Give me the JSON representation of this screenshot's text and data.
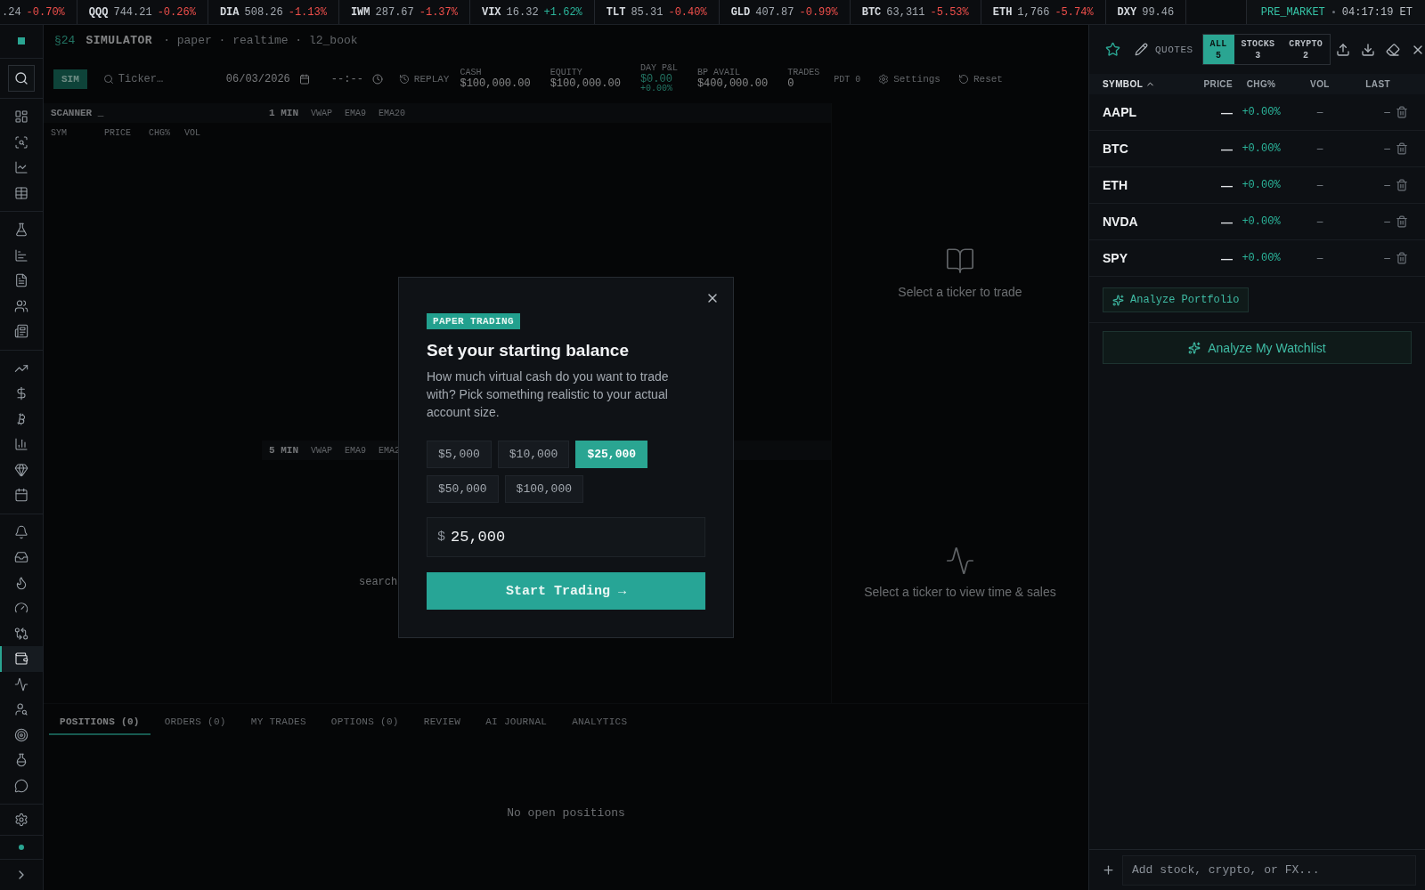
{
  "ticker": {
    "items": [
      {
        "price": ".24",
        "change": "-0.70%",
        "color": "#ef4f4b"
      },
      {
        "symbol": "QQQ",
        "price": "744.21",
        "change": "-0.26%",
        "color": "#ef4f4b"
      },
      {
        "symbol": "DIA",
        "price": "508.26",
        "change": "-1.13%",
        "color": "#ef4f4b"
      },
      {
        "symbol": "IWM",
        "price": "287.67",
        "change": "-1.37%",
        "color": "#ef4f4b"
      },
      {
        "symbol": "VIX",
        "price": "16.32",
        "change": "+1.62%",
        "color": "#2bb59b"
      },
      {
        "symbol": "TLT",
        "price": "85.31",
        "change": "-0.40%",
        "color": "#ef4f4b"
      },
      {
        "symbol": "GLD",
        "price": "407.87",
        "change": "-0.99%",
        "color": "#ef4f4b"
      },
      {
        "symbol": "BTC",
        "price": "63,311",
        "change": "-5.53%",
        "color": "#ef4f4b"
      },
      {
        "symbol": "ETH",
        "price": "1,766",
        "change": "-5.74%",
        "color": "#ef4f4b"
      },
      {
        "symbol": "DXY",
        "price": "99.46"
      }
    ],
    "session": "PRE_MARKET",
    "time": "04:17:19 ET"
  },
  "sidebar": {
    "groups": [
      {
        "items": [
          {
            "selected": false
          },
          {
            "selected": false
          },
          {
            "selected": false
          },
          {
            "selected": false
          }
        ]
      },
      {
        "items": [
          {
            "selected": false
          },
          {
            "selected": false
          },
          {
            "selected": false
          },
          {
            "selected": false
          },
          {
            "selected": false
          }
        ]
      },
      {
        "items": [
          {
            "selected": false
          },
          {
            "selected": false
          },
          {
            "selected": false
          },
          {
            "selected": false
          },
          {
            "selected": false
          },
          {
            "selected": false
          }
        ]
      },
      {
        "items": [
          {
            "selected": false
          },
          {
            "selected": false
          },
          {
            "selected": false
          },
          {
            "selected": false
          },
          {
            "selected": false
          },
          {
            "selected": true
          },
          {
            "selected": false
          },
          {
            "selected": false
          },
          {
            "selected": false
          },
          {
            "selected": false
          },
          {
            "selected": false
          }
        ]
      }
    ]
  },
  "main": {
    "header": {
      "code": "§24",
      "title": "SIMULATOR",
      "meta": "· paper · realtime · l2_book"
    },
    "toolbar": {
      "mode": "SIM",
      "ticker_placeholder": "Ticker…",
      "date": "06/03/2026",
      "time": "--:--",
      "replay": "REPLAY",
      "stats": [
        {
          "label": "CASH",
          "value": "$100,000.00"
        },
        {
          "label": "EQUITY",
          "value": "$100,000.00"
        },
        {
          "label": "DAY P&L",
          "value": "$0.00",
          "sub": "+0.00%",
          "kind": "pnl"
        },
        {
          "label": "BP AVAIL",
          "value": "$400,000.00"
        },
        {
          "label": "TRADES",
          "value": "0"
        }
      ],
      "pdt": "PDT 0",
      "settings": "Settings",
      "reset": "Reset"
    },
    "scanner": {
      "title": "SCANNER _",
      "columns": [
        "SYM",
        "PRICE",
        "CHG%",
        "VOL"
      ]
    },
    "charts": [
      {
        "timeframe": "1 MIN",
        "indicators": [
          "VWAP",
          "EMA9",
          "EMA20"
        ]
      },
      {
        "timeframe": "5 MIN",
        "indicators": [
          "VWAP",
          "EMA9",
          "EMA2"
        ],
        "hint": "search"
      }
    ],
    "side_panels": [
      {
        "message": "Select a ticker to trade"
      },
      {
        "message": "Select a ticker to view time & sales"
      }
    ],
    "bottom_tabs": [
      {
        "label": "POSITIONS (0)",
        "selected": true
      },
      {
        "label": "ORDERS (0)",
        "selected": false
      },
      {
        "label": "MY TRADES",
        "selected": false
      },
      {
        "label": "OPTIONS (0)",
        "selected": false
      },
      {
        "label": "REVIEW",
        "selected": false
      },
      {
        "label": "AI JOURNAL",
        "selected": false
      },
      {
        "label": "ANALYTICS",
        "selected": false
      }
    ],
    "empty_message": "No open positions"
  },
  "modal": {
    "badge": "PAPER TRADING",
    "title": "Set your starting balance",
    "description": "How much virtual cash do you want to trade with? Pick something realistic to your actual account size.",
    "presets": [
      {
        "label": "$5,000",
        "selected": false
      },
      {
        "label": "$10,000",
        "selected": false
      },
      {
        "label": "$25,000",
        "selected": true
      },
      {
        "label": "$50,000",
        "selected": false
      },
      {
        "label": "$100,000",
        "selected": false
      }
    ],
    "amount_prefix": "$",
    "amount": "25,000",
    "submit": "Start Trading →"
  },
  "watchlist": {
    "title": "QUOTES",
    "filters": [
      {
        "label": "ALL",
        "count": "5",
        "selected": true
      },
      {
        "label": "STOCKS",
        "count": "3",
        "selected": false
      },
      {
        "label": "CRYPTO",
        "count": "2",
        "selected": false
      }
    ],
    "columns": [
      {
        "label": "SYMBOL",
        "sorted": true
      },
      {
        "label": "PRICE",
        "sorted": false
      },
      {
        "label": "CHG%",
        "sorted": false
      },
      {
        "label": "VOL",
        "sorted": false
      },
      {
        "label": "LAST",
        "sorted": false
      }
    ],
    "rows": [
      {
        "symbol": "AAPL",
        "price": "—",
        "change": "+0.00%",
        "vol": "–",
        "last": "–"
      },
      {
        "symbol": "BTC",
        "price": "—",
        "change": "+0.00%",
        "vol": "–",
        "last": "–"
      },
      {
        "symbol": "ETH",
        "price": "—",
        "change": "+0.00%",
        "vol": "–",
        "last": "–"
      },
      {
        "symbol": "NVDA",
        "price": "—",
        "change": "+0.00%",
        "vol": "–",
        "last": "–"
      },
      {
        "symbol": "SPY",
        "price": "—",
        "change": "+0.00%",
        "vol": "–",
        "last": "–"
      }
    ],
    "analyze_portfolio": "Analyze Portfolio",
    "analyze_watchlist": "Analyze My Watchlist",
    "add_placeholder": "Add stock, crypto, or FX..."
  }
}
